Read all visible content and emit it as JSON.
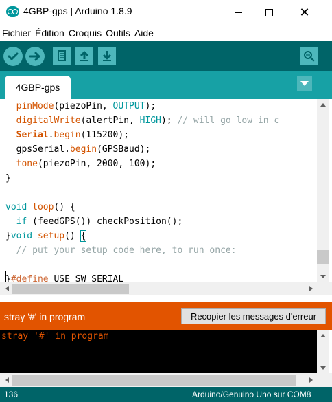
{
  "window": {
    "title": "4GBP-gps | Arduino 1.8.9",
    "logo_icon": "arduino-logo-icon",
    "minimize_icon": "minimize-icon",
    "maximize_icon": "maximize-icon",
    "close_icon": "close-icon",
    "close_glyph": "✕"
  },
  "menu": {
    "items": [
      "Fichier",
      "Édition",
      "Croquis",
      "Outils",
      "Aide"
    ]
  },
  "toolbar": {
    "buttons": [
      "verify-icon",
      "upload-icon",
      "new-icon",
      "open-icon",
      "save-icon"
    ],
    "serial_monitor_icon": "serial-monitor-icon"
  },
  "tabs": {
    "active": "4GBP-gps",
    "menu_icon": "tab-menu-dropdown-icon"
  },
  "editor": {
    "lines": [
      {
        "segments": [
          {
            "t": "  "
          },
          {
            "t": "pinMode",
            "c": "orange"
          },
          {
            "t": "(piezoPin, "
          },
          {
            "t": "OUTPUT",
            "c": "teal"
          },
          {
            "t": ");"
          }
        ]
      },
      {
        "segments": [
          {
            "t": "  "
          },
          {
            "t": "digitalWrite",
            "c": "orange"
          },
          {
            "t": "(alertPin, "
          },
          {
            "t": "HIGH",
            "c": "teal"
          },
          {
            "t": "); "
          },
          {
            "t": "// will go low in c",
            "c": "comment"
          }
        ]
      },
      {
        "segments": [
          {
            "t": "  "
          },
          {
            "t": "Serial",
            "c": "bold"
          },
          {
            "t": "."
          },
          {
            "t": "begin",
            "c": "orange"
          },
          {
            "t": "(115200);"
          }
        ]
      },
      {
        "segments": [
          {
            "t": "  gpsSerial."
          },
          {
            "t": "begin",
            "c": "orange"
          },
          {
            "t": "(GPSBaud);"
          }
        ]
      },
      {
        "segments": [
          {
            "t": "  "
          },
          {
            "t": "tone",
            "c": "orange"
          },
          {
            "t": "(piezoPin, 2000, 100);"
          }
        ]
      },
      {
        "segments": [
          {
            "t": "}"
          }
        ]
      },
      {
        "segments": [
          {
            "t": ""
          }
        ]
      },
      {
        "segments": [
          {
            "t": "void",
            "c": "teal"
          },
          {
            "t": " "
          },
          {
            "t": "loop",
            "c": "orange"
          },
          {
            "t": "() {"
          }
        ]
      },
      {
        "segments": [
          {
            "t": "  "
          },
          {
            "t": "if",
            "c": "teal"
          },
          {
            "t": " (feedGPS()) checkPosition();"
          }
        ]
      },
      {
        "segments": [
          {
            "t": "}"
          },
          {
            "t": "void",
            "c": "teal"
          },
          {
            "t": " "
          },
          {
            "t": "setup",
            "c": "orange"
          },
          {
            "t": "() "
          },
          {
            "t": "{",
            "c": "box"
          }
        ]
      },
      {
        "segments": [
          {
            "t": "  "
          },
          {
            "t": "// put your setup code here, to run once:",
            "c": "comment"
          }
        ]
      },
      {
        "segments": [
          {
            "t": ""
          }
        ]
      },
      {
        "segments": [
          {
            "t": "}"
          },
          {
            "t": "#define",
            "c": "red"
          },
          {
            "t": " USE_SW_SERIAL"
          }
        ]
      }
    ]
  },
  "status": {
    "message": "stray '#' in program",
    "copy_button_label": "Recopier les messages d'erreur"
  },
  "console": {
    "text": "stray '#' in program"
  },
  "footer": {
    "line_number": "136",
    "board": "Arduino/Genuino Uno sur COM8"
  },
  "colors": {
    "toolbar": "#006468",
    "tabbar": "#17a1a5",
    "button": "#4db7bb",
    "error_bar": "#e25400",
    "error_line": "#ffcccc"
  }
}
